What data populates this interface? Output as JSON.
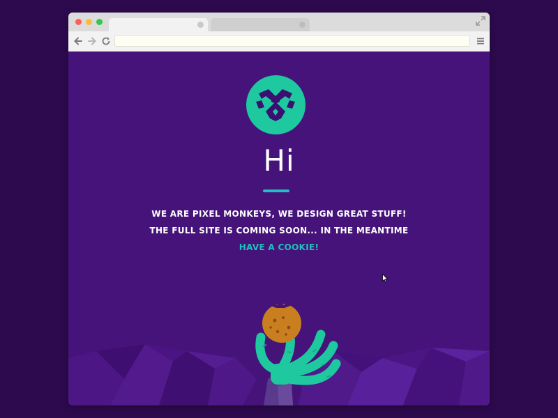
{
  "browser": {
    "url": "",
    "icons": {
      "back": "arrow-left-icon",
      "forward": "arrow-right-icon",
      "reload": "reload-icon",
      "menu": "hamburger-menu-icon",
      "expand": "expand-icon"
    }
  },
  "page": {
    "title": "Hi",
    "line1": "WE ARE PIXEL MONKEYS,  WE DESIGN GREAT STUFF!",
    "line2": "THE FULL SITE IS COMING SOON... IN THE MEANTIME",
    "cookie_link": "HAVE A COOKIE!"
  },
  "colors": {
    "outer_background": "#2d0a4e",
    "page_background": "#45137a",
    "accent_green": "#1fc99f",
    "accent_teal": "#1fc0c0",
    "cookie": "#c97f1f",
    "arm": "#5a3a8c"
  }
}
